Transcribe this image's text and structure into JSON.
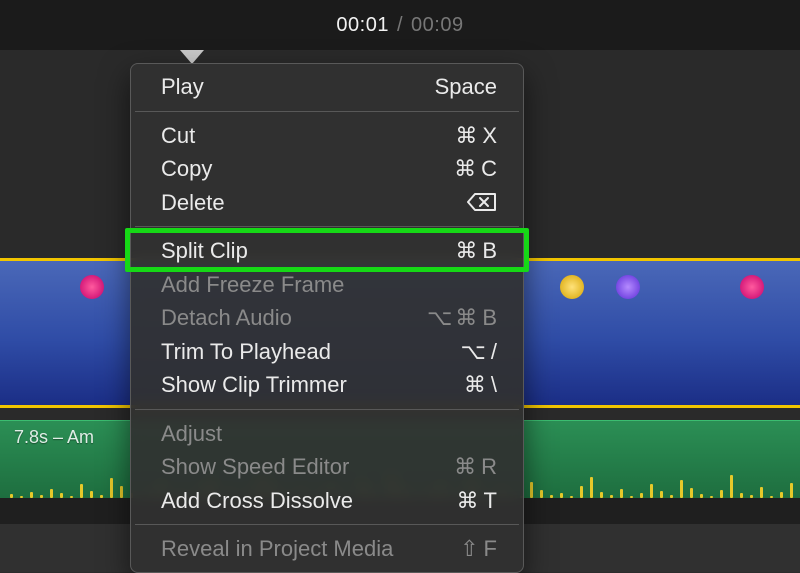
{
  "header": {
    "time_current": "00:01",
    "time_total": "00:09",
    "separator": "/"
  },
  "audio": {
    "label": "7.8s – Am"
  },
  "menu": {
    "groups": [
      [
        {
          "id": "play",
          "label": "Play",
          "shortcut": "Space",
          "enabled": true
        }
      ],
      [
        {
          "id": "cut",
          "label": "Cut",
          "shortcut": "⌘X",
          "enabled": true
        },
        {
          "id": "copy",
          "label": "Copy",
          "shortcut": "⌘C",
          "enabled": true
        },
        {
          "id": "delete",
          "label": "Delete",
          "shortcut_icon": "backspace",
          "enabled": true
        }
      ],
      [
        {
          "id": "split-clip",
          "label": "Split Clip",
          "shortcut": "⌘B",
          "enabled": true,
          "highlighted": true
        },
        {
          "id": "add-freeze-frame",
          "label": "Add Freeze Frame",
          "shortcut": "",
          "enabled": false
        },
        {
          "id": "detach-audio",
          "label": "Detach Audio",
          "shortcut": "⌥⌘B",
          "enabled": false
        },
        {
          "id": "trim-to-playhead",
          "label": "Trim To Playhead",
          "shortcut": "⌥/",
          "enabled": true
        },
        {
          "id": "show-clip-trimmer",
          "label": "Show Clip Trimmer",
          "shortcut": "⌘\\",
          "enabled": true
        }
      ],
      [
        {
          "id": "adjust",
          "label": "Adjust",
          "shortcut": "",
          "enabled": false
        },
        {
          "id": "show-speed-editor",
          "label": "Show Speed Editor",
          "shortcut": "⌘R",
          "enabled": false
        },
        {
          "id": "add-cross-dissolve",
          "label": "Add Cross Dissolve",
          "shortcut": "⌘T",
          "enabled": true
        }
      ],
      [
        {
          "id": "reveal-in-project-media",
          "label": "Reveal in Project Media",
          "shortcut": "⇧F",
          "enabled": false
        }
      ]
    ]
  },
  "highlight": {
    "target": "split-clip"
  }
}
